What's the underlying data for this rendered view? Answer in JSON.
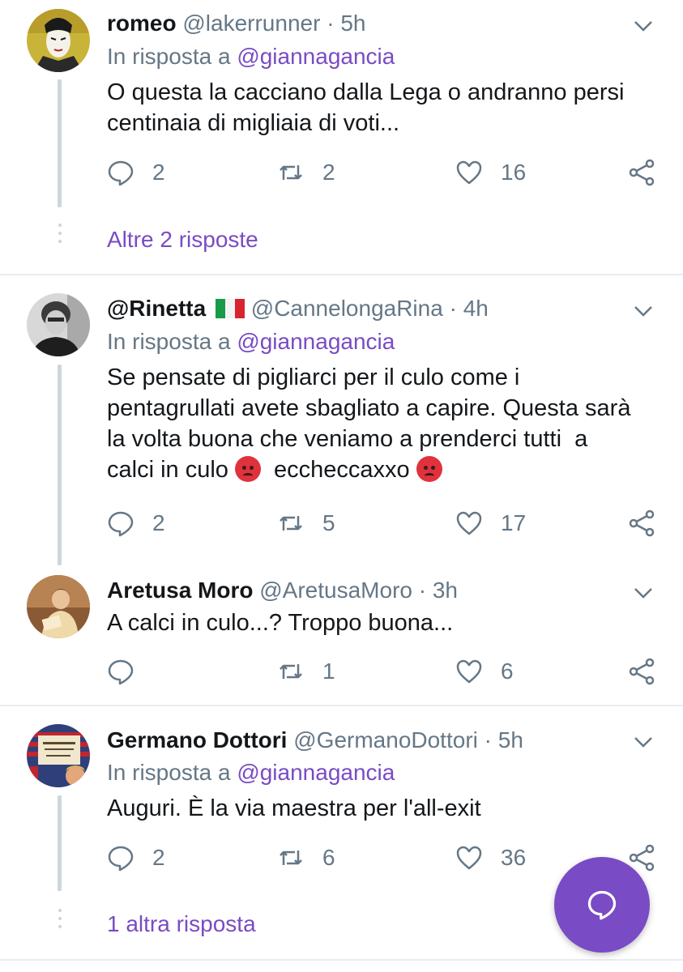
{
  "replies": [
    {
      "name": "romeo",
      "flag": "",
      "handle": "@lakerrunner",
      "time": "5h",
      "reply_prefix": "In risposta a",
      "reply_to": "@giannagancia",
      "text_lines": [
        "O questa la cacciano dalla Lega o andranno persi",
        "centinaia di migliaia di voti..."
      ],
      "counts": {
        "reply": "2",
        "retweet": "2",
        "like": "16"
      },
      "more": "Altre 2 risposte"
    },
    {
      "name": "@Rinetta",
      "flag": "italy-flag",
      "handle": "@CannelongaRina",
      "time": "4h",
      "reply_prefix": "In risposta a",
      "reply_to": "@giannagancia",
      "text_lines": [
        "Se pensate di pigliarci per il culo come i",
        "pentagrullati avete sbagliato a capire. Questa sarà",
        "la volta buona che veniamo a prenderci tutti  a",
        "calci in culo",
        "eccheccaxxo"
      ],
      "counts": {
        "reply": "2",
        "retweet": "5",
        "like": "17"
      }
    },
    {
      "name": "Aretusa Moro",
      "handle": "@AretusaMoro",
      "time": "3h",
      "text_lines": [
        "A calci in culo...? Troppo buona..."
      ],
      "counts": {
        "reply": "",
        "retweet": "1",
        "like": "6"
      }
    },
    {
      "name": "Germano Dottori",
      "handle": "@GermanoDottori",
      "time": "5h",
      "reply_prefix": "In risposta a",
      "reply_to": "@giannagancia",
      "text_lines": [
        "Auguri. È la via maestra per l'all-exit"
      ],
      "counts": {
        "reply": "2",
        "retweet": "6",
        "like": "36"
      },
      "more": "1 altra risposta"
    }
  ],
  "separator": "·",
  "colors": {
    "accent": "#794bc4",
    "muted": "#657786",
    "text": "#14171a",
    "line": "#ccd6dd"
  }
}
